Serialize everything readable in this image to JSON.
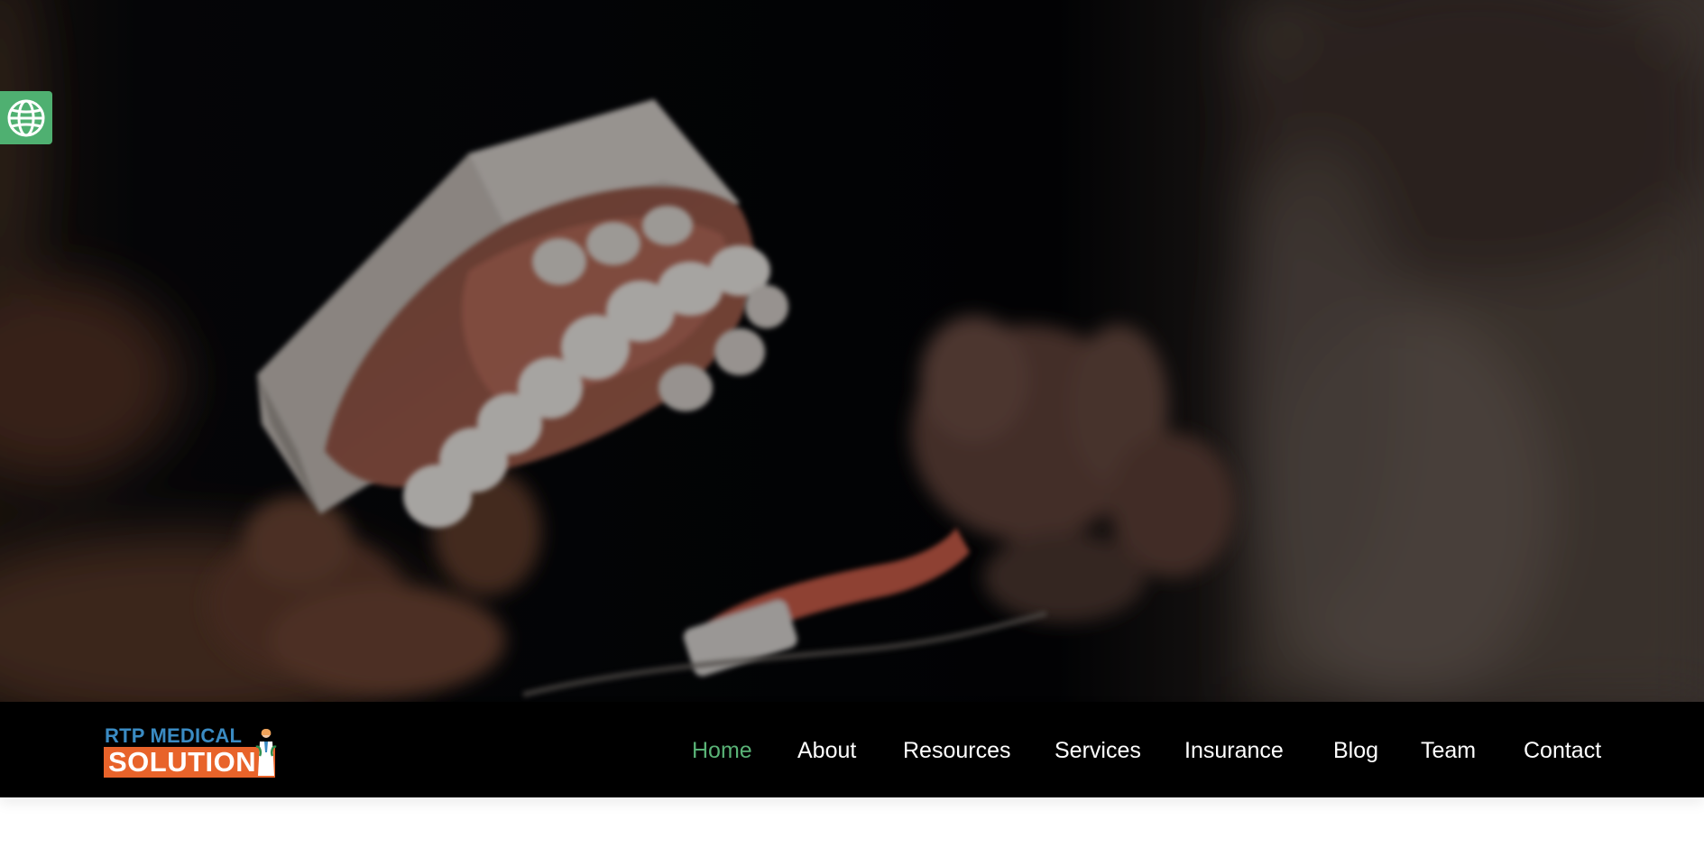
{
  "header": {
    "logo": {
      "line1": "RTP MEDICAL",
      "line2": "SOLUTION"
    },
    "nav": [
      {
        "label": "Home",
        "active": true
      },
      {
        "label": "About",
        "active": false
      },
      {
        "label": "Resources",
        "active": false
      },
      {
        "label": "Services",
        "active": false
      },
      {
        "label": "Insurance",
        "active": false
      },
      {
        "label": "Blog",
        "active": false
      },
      {
        "label": "Team",
        "active": false
      },
      {
        "label": "Contact",
        "active": false
      }
    ]
  },
  "translate_widget": {
    "icon": "globe-icon"
  },
  "hero": {
    "image": "dental-model-and-toothbrush-photo"
  },
  "colors": {
    "accent_green": "#59b276",
    "widget_green": "#4fb071",
    "logo_blue": "#3a8bc3",
    "logo_orange": "#e8632a",
    "nav_background": "#000000",
    "nav_text": "#ffffff"
  }
}
